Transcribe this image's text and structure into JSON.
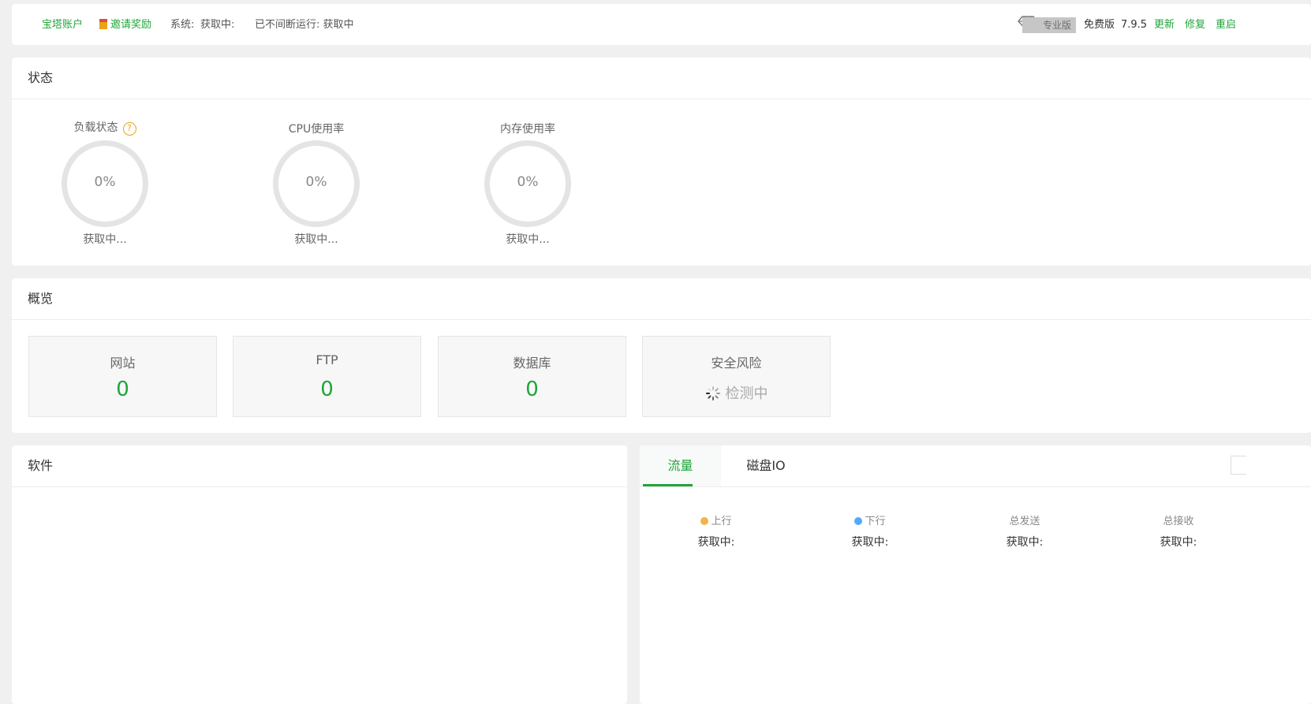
{
  "topbar": {
    "account": "宝塔账户",
    "invite": "邀请奖励",
    "system_label": "系统:",
    "system_value": "获取中:",
    "uptime": "已不间断运行: 获取中",
    "pro_badge": "专业版",
    "free_edition": "免费版",
    "version": "7.9.5",
    "update": "更新",
    "repair": "修复",
    "restart": "重启"
  },
  "status": {
    "title": "状态",
    "gauges": [
      {
        "label": "负载状态",
        "value": "0%",
        "sub": "获取中..."
      },
      {
        "label": "CPU使用率",
        "value": "0%",
        "sub": "获取中..."
      },
      {
        "label": "内存使用率",
        "value": "0%",
        "sub": "获取中..."
      }
    ],
    "help_icon": "?"
  },
  "overview": {
    "title": "概览",
    "tiles": [
      {
        "label": "网站",
        "value": "0"
      },
      {
        "label": "FTP",
        "value": "0"
      },
      {
        "label": "数据库",
        "value": "0"
      },
      {
        "label": "安全风险",
        "value": "检测中"
      }
    ]
  },
  "software": {
    "title": "软件"
  },
  "traffic": {
    "tabs": [
      "流量",
      "磁盘IO"
    ],
    "stats": [
      {
        "label": "上行",
        "value": "获取中:",
        "color": "#f0b449"
      },
      {
        "label": "下行",
        "value": "获取中:",
        "color": "#52a9ff"
      },
      {
        "label": "总发送",
        "value": "获取中:"
      },
      {
        "label": "总接收",
        "value": "获取中:"
      }
    ]
  },
  "colors": {
    "accent": "#20a53a",
    "warning": "#e8a317"
  }
}
